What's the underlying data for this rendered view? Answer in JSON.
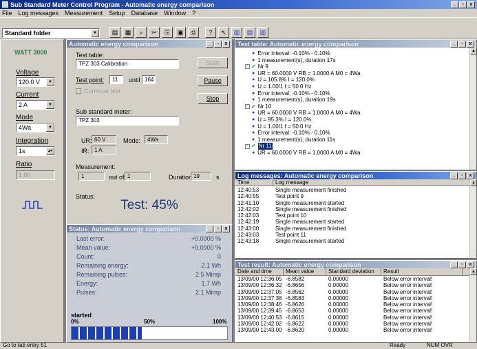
{
  "app": {
    "title": "Sub Standard Meter Control Program - Automatic energy comparison",
    "menu": [
      "File",
      "Log messages",
      "Measurement",
      "Setup",
      "Database",
      "Window",
      "?"
    ],
    "folder_combo": "Standard folder",
    "status_left": "Go to tab entry 51",
    "status_mid": "Ready",
    "status_right": "NUM  OVR",
    "colors": {
      "title_active": "#0a2a86",
      "workspace": "#808080",
      "progress": "#1c3fb8",
      "test_text": "#1b3a7a"
    }
  },
  "left_panel": {
    "device": "WATT 3000",
    "voltage_label": "Voltage",
    "voltage_value": "120.0 V",
    "current_label": "Current",
    "current_value": "2 A",
    "mode_label": "Mode",
    "mode_value": "4Wa",
    "integration_label": "Integration",
    "integration_value": "1s",
    "ratio_label": "Ratio",
    "ratio_value": "1.00"
  },
  "main_window": {
    "title": "Automatic energy comparison",
    "test_table_label": "Test table:",
    "test_table_value": "TPZ 303 Calibration",
    "test_point_label": "Test point:",
    "test_point_value": "11",
    "until_label": "until",
    "until_value": "164",
    "start_label": "Start",
    "pause_label": "Pause",
    "stop_label": "Stop",
    "continue_label": "Continue test",
    "sub_meter_label": "Sub standard meter:",
    "sub_meter_value": "TPZ 303",
    "ur_label": "UR:",
    "ur_value": "60 V",
    "mode_label": "Mode:",
    "mode_value": "4Wa",
    "ir_label": "IR:",
    "ir_value": "1 A",
    "measurement_label": "Measurement:",
    "meas_value": "1",
    "out_of_label": "out of",
    "out_of_value": "1",
    "duration_label": "Duration",
    "duration_value": "19",
    "duration_unit": "s",
    "status_label": "Status:",
    "status_text": "Test: 45%"
  },
  "status_window": {
    "title": "Status: Automatic energy comparison",
    "rows": [
      {
        "label": "Last error:",
        "value": "+0.0000 %"
      },
      {
        "label": "Mean value:",
        "value": "+0.0000 %"
      },
      {
        "label": "Count:",
        "value": "0"
      },
      {
        "label": "Remaining energy:",
        "value": "2.1 Wh"
      },
      {
        "label": "Remaining pulses:",
        "value": "2.5 Mimp"
      },
      {
        "label": "Energy:",
        "value": "1.7 Wh"
      },
      {
        "label": "Pulses:",
        "value": "2.1 Mimp"
      }
    ],
    "progress_state": "started",
    "p0": "0%",
    "p50": "50%",
    "p100": "100%",
    "progress_fraction": 0.45
  },
  "test_table_window": {
    "title": "Test table: Automatic energy comparison",
    "lines": [
      {
        "indent": 2,
        "icon": "bullet",
        "text": "Error interval: -0.10% - 0.10%"
      },
      {
        "indent": 2,
        "icon": "bullet",
        "text": "1 measurement(s), duration 17s"
      },
      {
        "indent": 1,
        "icon": "check",
        "text": "Nr 9"
      },
      {
        "indent": 2,
        "icon": "bullet",
        "text": "UR = 60.0000 V  RB = 1.0000 A  M0 = 4Wa"
      },
      {
        "indent": 2,
        "icon": "bullet",
        "text": "U = 105.8%  I = 120.0%"
      },
      {
        "indent": 2,
        "icon": "bullet",
        "text": "U = 1.00/1  f = 50.0 Hz"
      },
      {
        "indent": 2,
        "icon": "bullet",
        "text": "Error interval: -0.10% - 0.10%"
      },
      {
        "indent": 2,
        "icon": "bullet",
        "text": "1 measurement(s), duration 19s"
      },
      {
        "indent": 1,
        "icon": "check",
        "text": "Nr 10"
      },
      {
        "indent": 2,
        "icon": "bullet",
        "text": "UR = 60.0000 V  RB = 1.0000 A  M0 = 4Wa"
      },
      {
        "indent": 2,
        "icon": "bullet",
        "text": "U = 95.3%  I = 120.0%"
      },
      {
        "indent": 2,
        "icon": "bullet",
        "text": "U = 1.00/1  f = 50.0 Hz"
      },
      {
        "indent": 2,
        "icon": "bullet",
        "text": "Error interval: -0.10% - 0.10%"
      },
      {
        "indent": 2,
        "icon": "bullet",
        "text": "1 measurement(s), duration 11s"
      },
      {
        "indent": 1,
        "icon": "check",
        "text": "Nr 11",
        "selected": true
      },
      {
        "indent": 2,
        "icon": "bullet",
        "text": "UR = 60.0000 V  RB = 1.0000 A  M0 = 4Wa"
      }
    ]
  },
  "log_window": {
    "title": "Log messages: Automatic energy comparison",
    "col_time": "Time",
    "col_msg": "Log message",
    "rows": [
      {
        "time": "12:40:53",
        "msg": "Single measurement finished"
      },
      {
        "time": "12:40:55",
        "msg": "Test point 9"
      },
      {
        "time": "12:41:10",
        "msg": "Single measurement started"
      },
      {
        "time": "12:42:02",
        "msg": "Single measurement finished"
      },
      {
        "time": "12:42:03",
        "msg": "Test point 10"
      },
      {
        "time": "12:42:19",
        "msg": "Single measurement started"
      },
      {
        "time": "12:43:00",
        "msg": "Single measurement finished"
      },
      {
        "time": "12:43:03",
        "msg": "Test point 11"
      },
      {
        "time": "12:43:18",
        "msg": "Single measurement started"
      }
    ]
  },
  "result_window": {
    "title": "Test result: Automatic energy comparison",
    "columns": [
      "Date and time",
      "Mean value",
      "Standard deviation",
      "Result"
    ],
    "rows": [
      [
        "13/09/00 12:36:05",
        "-6.8582",
        "0.00000",
        "Below error interval!"
      ],
      [
        "13/09/00 12:36:32",
        "-6.8656",
        "0.00000",
        "Below error interval!"
      ],
      [
        "13/09/00 12:37:05",
        "-6.8562",
        "0.00000",
        "Below error interval!"
      ],
      [
        "13/09/00 12:37:38",
        "-6.8583",
        "0.00000",
        "Below error interval!"
      ],
      [
        "13/09/00 12:38:46",
        "-6.8626",
        "0.00000",
        "Below error interval!"
      ],
      [
        "13/09/00 12:39:45",
        "-6.8653",
        "0.00000",
        "Below error interval!"
      ],
      [
        "13/09/00 12:40:53",
        "-6.8615",
        "0.00000",
        "Below error interval!"
      ],
      [
        "13/09/00 12:42:02",
        "-6.8622",
        "0.00000",
        "Below error interval!"
      ],
      [
        "13/09/00 12:43:00",
        "-6.8620",
        "0.00000",
        "Below error interval!"
      ]
    ]
  }
}
